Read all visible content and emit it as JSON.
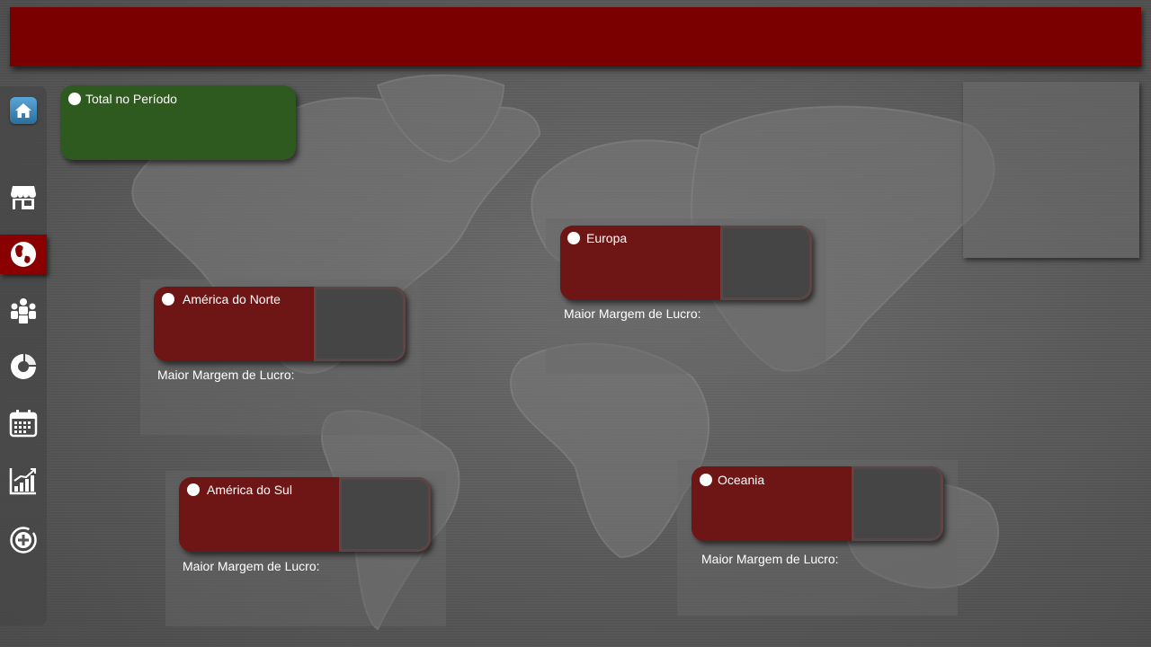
{
  "header": {
    "title": ""
  },
  "sidebar": {
    "items": [
      {
        "icon": "home-icon"
      },
      {
        "icon": "store-icon"
      },
      {
        "icon": "globe-icon",
        "active": true
      },
      {
        "icon": "group-icon"
      },
      {
        "icon": "donut-chart-icon"
      },
      {
        "icon": "calendar-icon"
      },
      {
        "icon": "bar-chart-icon"
      },
      {
        "icon": "add-circle-icon"
      }
    ]
  },
  "total": {
    "label": "Total no Período"
  },
  "regions": [
    {
      "name": "América do Norte",
      "margin_label": "Maior Margem de Lucro:"
    },
    {
      "name": "Europa",
      "margin_label": "Maior Margem de Lucro:"
    },
    {
      "name": "América do Sul",
      "margin_label": "Maior Margem de Lucro:"
    },
    {
      "name": "Oceania",
      "margin_label": "Maior Margem de Lucro:"
    }
  ],
  "colors": {
    "header": "#7a0000",
    "total_card": "#2f5a1f",
    "region_card": "#6e1515",
    "active_nav": "#8a0000"
  }
}
